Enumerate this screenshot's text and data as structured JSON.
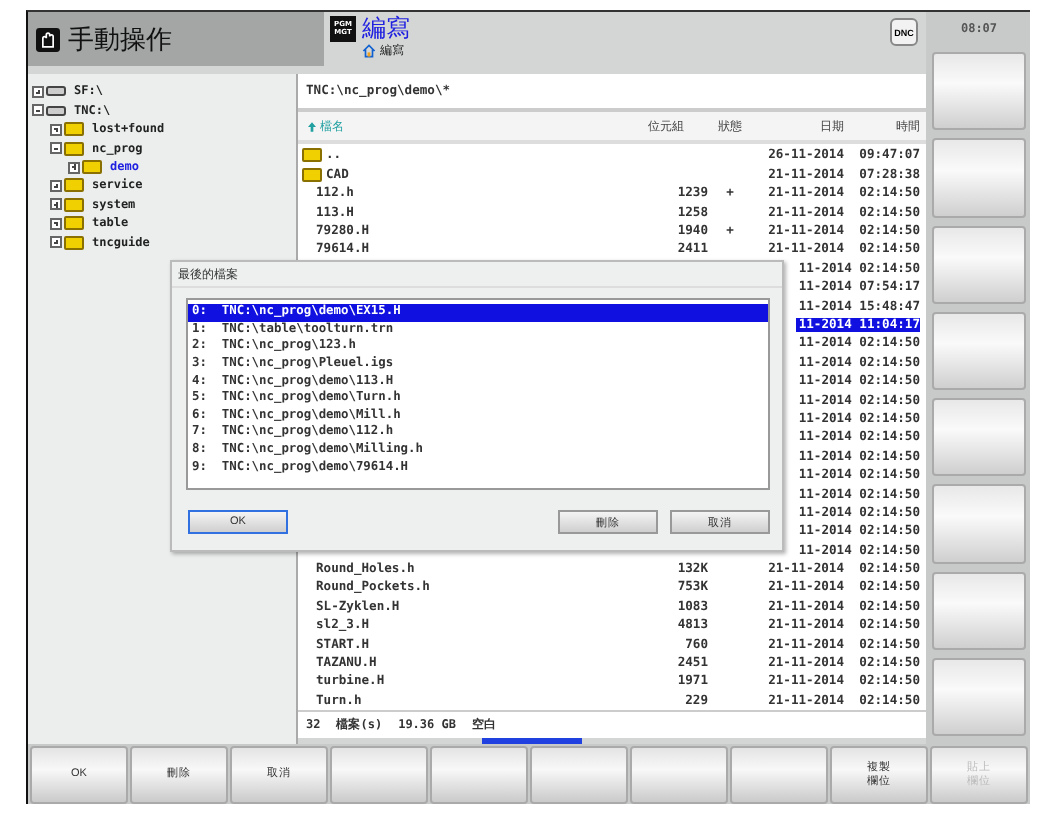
{
  "header": {
    "mode_title": "手動操作",
    "program_mode": {
      "icon_text": [
        "PGM",
        "MGT"
      ],
      "title": "編寫",
      "subtitle": "編寫"
    },
    "dnc_button": "DNC",
    "clock": "08:07"
  },
  "tree": [
    {
      "label": "SF:\\",
      "kind": "drive",
      "expanded": false,
      "selected": false
    },
    {
      "label": "TNC:\\",
      "kind": "drive",
      "expanded": true,
      "selected": false,
      "children": [
        {
          "label": "lost+found",
          "kind": "folder",
          "expanded": false,
          "selected": false
        },
        {
          "label": "nc_prog",
          "kind": "folder",
          "expanded": true,
          "selected": false,
          "children": [
            {
              "label": "demo",
              "kind": "folder",
              "expanded": false,
              "selected": true
            }
          ]
        },
        {
          "label": "service",
          "kind": "folder",
          "expanded": false,
          "selected": false
        },
        {
          "label": "system",
          "kind": "folder",
          "expanded": false,
          "selected": false
        },
        {
          "label": "table",
          "kind": "folder",
          "expanded": false,
          "selected": false
        },
        {
          "label": "tncguide",
          "kind": "folder",
          "expanded": false,
          "selected": false
        }
      ]
    }
  ],
  "file_panel": {
    "path": "TNC:\\nc_prog\\demo\\*",
    "columns": [
      "檔名",
      "位元組",
      "狀態",
      "日期",
      "時間"
    ],
    "rows": [
      {
        "kind": "folder",
        "name": "..",
        "date": "26-11-2014",
        "time": "09:47:07",
        "selected": false
      },
      {
        "kind": "folder",
        "name": "CAD",
        "date": "21-11-2014",
        "time": "07:28:38",
        "selected": false
      },
      {
        "kind": "file",
        "name": "112.h",
        "size": "1239",
        "status": "+",
        "date": "21-11-2014",
        "time": "02:14:50",
        "selected": false
      },
      {
        "kind": "file",
        "name": "113.H",
        "size": "1258",
        "date": "21-11-2014",
        "time": "02:14:50",
        "selected": false
      },
      {
        "kind": "file",
        "name": "79280.H",
        "size": "1940",
        "status": "+",
        "date": "21-11-2014",
        "time": "02:14:50",
        "selected": false
      },
      {
        "kind": "file",
        "name": "79614.H",
        "size": "2411",
        "date": "21-11-2014",
        "time": "02:14:50",
        "selected": false
      },
      {
        "kind": "covered",
        "date": "11-2014",
        "time": "02:14:50",
        "selected": false
      },
      {
        "kind": "covered",
        "date": "11-2014",
        "time": "07:54:17",
        "selected": false
      },
      {
        "kind": "covered",
        "date": "11-2014",
        "time": "15:48:47",
        "selected": false
      },
      {
        "kind": "covered",
        "date": "11-2014",
        "time": "11:04:17",
        "selected": true
      },
      {
        "kind": "covered",
        "date": "11-2014",
        "time": "02:14:50",
        "selected": false
      },
      {
        "kind": "covered",
        "date": "11-2014",
        "time": "02:14:50",
        "selected": false
      },
      {
        "kind": "covered",
        "date": "11-2014",
        "time": "02:14:50",
        "selected": false
      },
      {
        "kind": "covered",
        "date": "11-2014",
        "time": "02:14:50",
        "selected": false
      },
      {
        "kind": "covered",
        "date": "11-2014",
        "time": "02:14:50",
        "selected": false
      },
      {
        "kind": "covered",
        "date": "11-2014",
        "time": "02:14:50",
        "selected": false
      },
      {
        "kind": "covered",
        "date": "11-2014",
        "time": "02:14:50",
        "selected": false
      },
      {
        "kind": "covered",
        "date": "11-2014",
        "time": "02:14:50",
        "selected": false
      },
      {
        "kind": "covered",
        "date": "11-2014",
        "time": "02:14:50",
        "selected": false
      },
      {
        "kind": "covered",
        "date": "11-2014",
        "time": "02:14:50",
        "selected": false
      },
      {
        "kind": "covered",
        "date": "11-2014",
        "time": "02:14:50",
        "selected": false
      },
      {
        "kind": "covered",
        "date": "11-2014",
        "time": "02:14:50",
        "selected": false
      },
      {
        "kind": "file",
        "name": "Round_Holes.h",
        "size": "132K",
        "date": "21-11-2014",
        "time": "02:14:50",
        "selected": false
      },
      {
        "kind": "file",
        "name": "Round_Pockets.h",
        "size": "753K",
        "date": "21-11-2014",
        "time": "02:14:50",
        "selected": false
      },
      {
        "kind": "file",
        "name": "SL-Zyklen.H",
        "size": "1083",
        "date": "21-11-2014",
        "time": "02:14:50",
        "selected": false
      },
      {
        "kind": "file",
        "name": "sl2_3.H",
        "size": "4813",
        "date": "21-11-2014",
        "time": "02:14:50",
        "selected": false
      },
      {
        "kind": "file",
        "name": "START.H",
        "size": "760",
        "date": "21-11-2014",
        "time": "02:14:50",
        "selected": false
      },
      {
        "kind": "file",
        "name": "TAZANU.H",
        "size": "2451",
        "date": "21-11-2014",
        "time": "02:14:50",
        "selected": false
      },
      {
        "kind": "file",
        "name": "turbine.H",
        "size": "1971",
        "date": "21-11-2014",
        "time": "02:14:50",
        "selected": false
      },
      {
        "kind": "file",
        "name": "Turn.h",
        "size": "229",
        "date": "21-11-2014",
        "time": "02:14:50",
        "selected": false
      }
    ],
    "status": [
      "32",
      "檔案(s)",
      "19.36 GB",
      "空白"
    ]
  },
  "dialog": {
    "title": "最後的檔案",
    "items": [
      {
        "label": "0:  TNC:\\nc_prog\\demo\\EX15.H",
        "selected": true
      },
      {
        "label": "1:  TNC:\\table\\toolturn.trn",
        "selected": false
      },
      {
        "label": "2:  TNC:\\nc_prog\\123.h",
        "selected": false
      },
      {
        "label": "3:  TNC:\\nc_prog\\Pleuel.igs",
        "selected": false
      },
      {
        "label": "4:  TNC:\\nc_prog\\demo\\113.H",
        "selected": false
      },
      {
        "label": "5:  TNC:\\nc_prog\\demo\\Turn.h",
        "selected": false
      },
      {
        "label": "6:  TNC:\\nc_prog\\demo\\Mill.h",
        "selected": false
      },
      {
        "label": "7:  TNC:\\nc_prog\\demo\\112.h",
        "selected": false
      },
      {
        "label": "8:  TNC:\\nc_prog\\demo\\Milling.h",
        "selected": false
      },
      {
        "label": "9:  TNC:\\nc_prog\\demo\\79614.H",
        "selected": false
      }
    ],
    "buttons": [
      {
        "label": "OK",
        "focused": true
      },
      {
        "label": "刪除",
        "focused": false
      },
      {
        "label": "取消",
        "focused": false
      }
    ]
  },
  "side_softkeys": [
    {
      "kind": "blank"
    },
    {
      "kind": "blank"
    },
    {
      "kind": "blank"
    },
    {
      "kind": "blank"
    },
    {
      "kind": "blank"
    },
    {
      "kind": "blank"
    },
    {
      "kind": "blank"
    },
    {
      "kind": "blank"
    }
  ],
  "softkeys": [
    {
      "kind": "label",
      "lines": [
        "OK"
      ],
      "disabled": false
    },
    {
      "kind": "label",
      "lines": [
        "刪除"
      ],
      "disabled": false
    },
    {
      "kind": "label",
      "lines": [
        "取消"
      ],
      "disabled": false
    },
    {
      "kind": "blank"
    },
    {
      "kind": "blank"
    },
    {
      "kind": "blank"
    },
    {
      "kind": "blank"
    },
    {
      "kind": "blank"
    },
    {
      "kind": "label",
      "lines": [
        "複製",
        "欄位"
      ],
      "disabled": false
    },
    {
      "kind": "label",
      "lines": [
        "貼上",
        "欄位"
      ],
      "disabled": true
    }
  ]
}
